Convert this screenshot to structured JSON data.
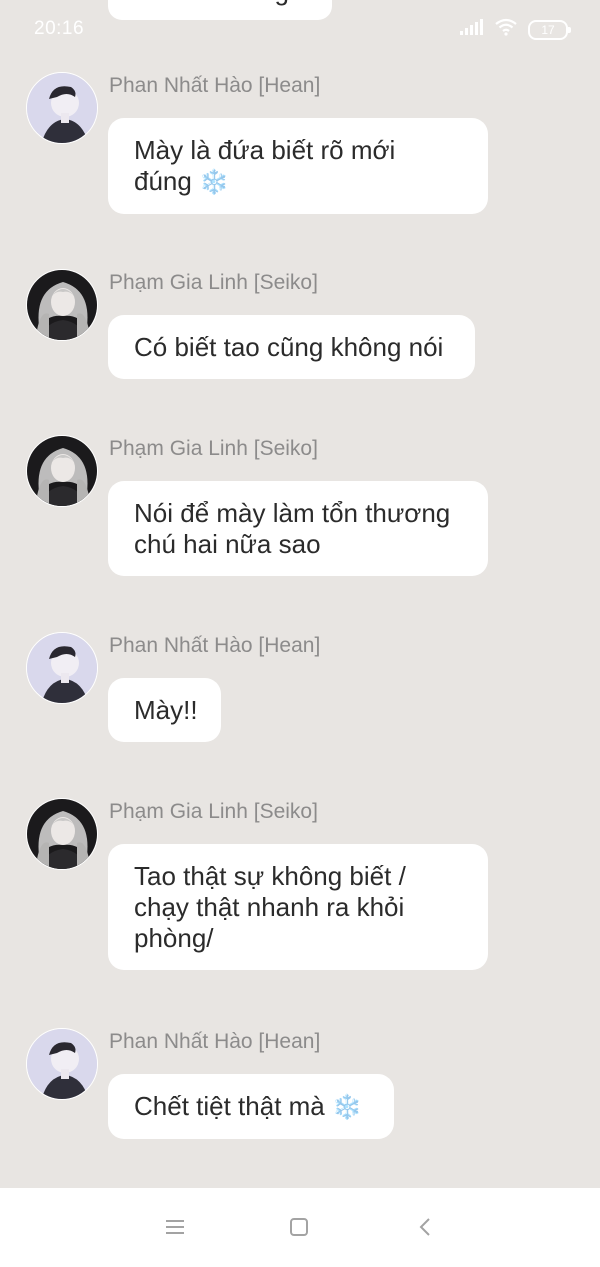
{
  "status_bar": {
    "time": "20:16",
    "battery_level": "17",
    "icons": [
      "signal-icon",
      "wifi-icon",
      "battery-icon"
    ]
  },
  "previous_message": {
    "text_fragment": "ng"
  },
  "messages": [
    {
      "sender": "Phan Nhất Hào [Hean]",
      "avatar": "avatar-hean",
      "lines": [
        "Mày là đứa biết rõ mới",
        "đúng"
      ],
      "emoji": "❄️"
    },
    {
      "sender": "Phạm Gia Linh [Seiko]",
      "avatar": "avatar-seiko",
      "lines": [
        "Có biết tao cũng không nói"
      ]
    },
    {
      "sender": "Phạm Gia Linh [Seiko]",
      "avatar": "avatar-seiko",
      "lines": [
        "Nói để mày làm tổn thương",
        "chú hai nữa sao"
      ]
    },
    {
      "sender": "Phan Nhất Hào [Hean]",
      "avatar": "avatar-hean",
      "lines": [
        "Mày!!"
      ]
    },
    {
      "sender": "Phạm Gia Linh [Seiko]",
      "avatar": "avatar-seiko",
      "lines": [
        "Tao thật sự không biết /",
        "chạy thật nhanh ra khỏi",
        "phòng/"
      ]
    },
    {
      "sender": "Phan Nhất Hào [Hean]",
      "avatar": "avatar-hean",
      "lines": [
        "Chết tiệt thật mà"
      ],
      "emoji": "❄️"
    }
  ],
  "nav_bar": {
    "buttons": [
      "menu-icon",
      "home-icon",
      "back-icon"
    ]
  },
  "colors": {
    "background": "#e8e5e2",
    "bubble": "#ffffff",
    "sender_text": "#8c8b8b",
    "message_text": "#2b2b2b",
    "emoji": "#8fb8dc"
  }
}
